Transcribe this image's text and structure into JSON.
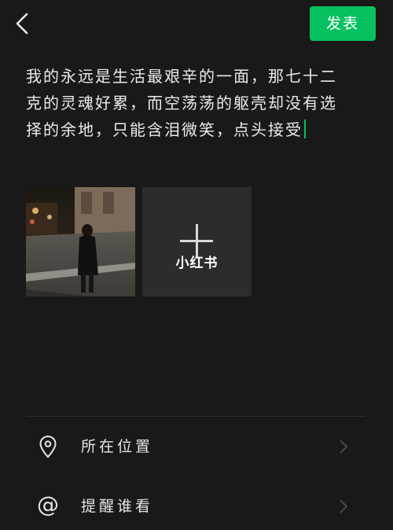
{
  "header": {
    "back_icon": "chevron-left-icon",
    "publish_label": "发表",
    "accent_color": "#07c160"
  },
  "post": {
    "text": "我的永远是生活最艰辛的一面，那七十二克的灵魂好累，而空荡荡的躯壳却没有选择的余地，只能含泪微笑，点头接受"
  },
  "media": {
    "photo_alt": "night street photo",
    "add_icon": "plus-icon",
    "watermark": "小红书"
  },
  "options": [
    {
      "icon": "location-pin-icon",
      "label": "所在位置"
    },
    {
      "icon": "at-icon",
      "label": "提醒谁看"
    }
  ]
}
